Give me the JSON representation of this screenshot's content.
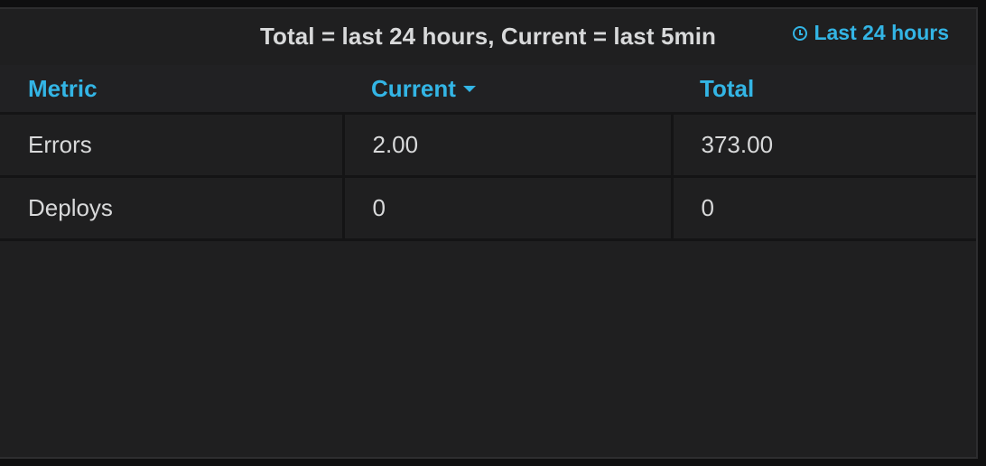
{
  "panel": {
    "title": "Total = last 24 hours, Current = last 5min",
    "time_info": "Last 24 hours",
    "time_icon": "clock-icon"
  },
  "table": {
    "headers": {
      "metric": "Metric",
      "current": "Current",
      "total": "Total"
    },
    "sort": {
      "column": "current",
      "direction": "desc"
    },
    "rows": [
      {
        "metric": "Errors",
        "current": "2.00",
        "total": "373.00"
      },
      {
        "metric": "Deploys",
        "current": "0",
        "total": "0"
      }
    ]
  },
  "colors": {
    "accent": "#33b5e5",
    "text": "#d8d9da",
    "panel_bg": "#1f1f20",
    "page_bg": "#0f0f10"
  }
}
